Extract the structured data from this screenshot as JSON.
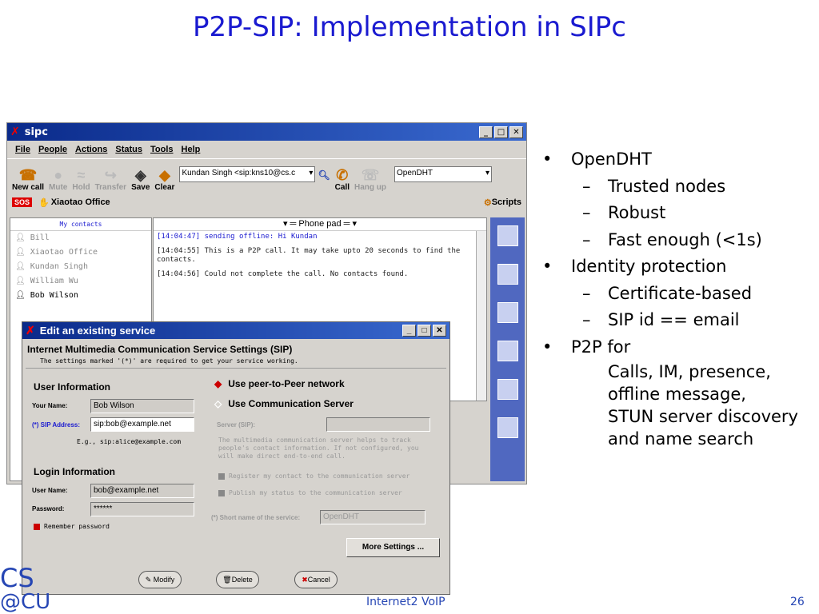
{
  "slide": {
    "title": "P2P-SIP: Implementation in SIPc",
    "footer_center": "Internet2 VoIP",
    "page_number": "26",
    "logo_top": "CS",
    "logo_bottom": "@CU",
    "bullets": [
      {
        "text": "OpenDHT",
        "sub": [
          "Trusted nodes",
          "Robust",
          "Fast enough (<1s)"
        ]
      },
      {
        "text": "Identity protection",
        "sub": [
          "Certificate-based",
          "SIP id == email"
        ]
      },
      {
        "text": "P2P for",
        "para": [
          "Calls, IM, presence,",
          "offline message,",
          "STUN server discovery",
          "and name search"
        ]
      }
    ]
  },
  "sipc": {
    "title": "sipc",
    "menu": [
      "File",
      "People",
      "Actions",
      "Status",
      "Tools",
      "Help"
    ],
    "toolbar": {
      "new_call": "New call",
      "mute": "Mute",
      "hold": "Hold",
      "transfer": "Transfer",
      "save": "Save",
      "clear": "Clear",
      "call": "Call",
      "hang_up": "Hang up",
      "contact_combo": "Kundan Singh <sip:kns10@cs.c",
      "service_combo": "OpenDHT"
    },
    "sos": "SOS",
    "office": "Xiaotao Office",
    "scripts": "Scripts",
    "contacts_header": "My contacts",
    "contacts": [
      "Bill",
      "Xiaotao Office",
      "Kundan Singh",
      "William Wu",
      "Bob Wilson"
    ],
    "phone_pad": "Phone pad",
    "log": [
      "[14:04:47] sending offline: Hi Kundan",
      "[14:04:55] This is a P2P call. It may take upto 20 seconds to find the contacts.",
      "[14:04:56] Could not complete the call. No contacts found."
    ]
  },
  "dialog": {
    "title": "Edit an existing service",
    "heading": "Internet Multimedia Communication Service Settings (SIP)",
    "subtitle": "The settings marked '(*)' are required to get your service working.",
    "user_info": "User Information",
    "your_name_label": "Your Name:",
    "your_name_value": "Bob Wilson",
    "sip_label": "(*) SIP Address:",
    "sip_value": "sip:bob@example.net",
    "sip_hint": "E.g., sip:alice@example.com",
    "login_info": "Login Information",
    "user_name_label": "User Name:",
    "user_name_value": "bob@example.net",
    "password_label": "Password:",
    "password_value": "******",
    "remember": "Remember password",
    "opt_p2p": "Use peer-to-Peer network",
    "opt_server": "Use Communication Server",
    "server_label": "Server (SIP):",
    "server_desc": "The multimedia communication server helps to track people's contact information. If not configured, you will make direct end-to-end call.",
    "register": "Register my contact to the communication server",
    "publish": "Publish my status to the communication server",
    "short_name_label": "(*) Short name of the service:",
    "short_name_value": "OpenDHT",
    "more_settings": "More Settings ...",
    "modify": "Modify",
    "delete": "Delete",
    "cancel": "Cancel"
  }
}
